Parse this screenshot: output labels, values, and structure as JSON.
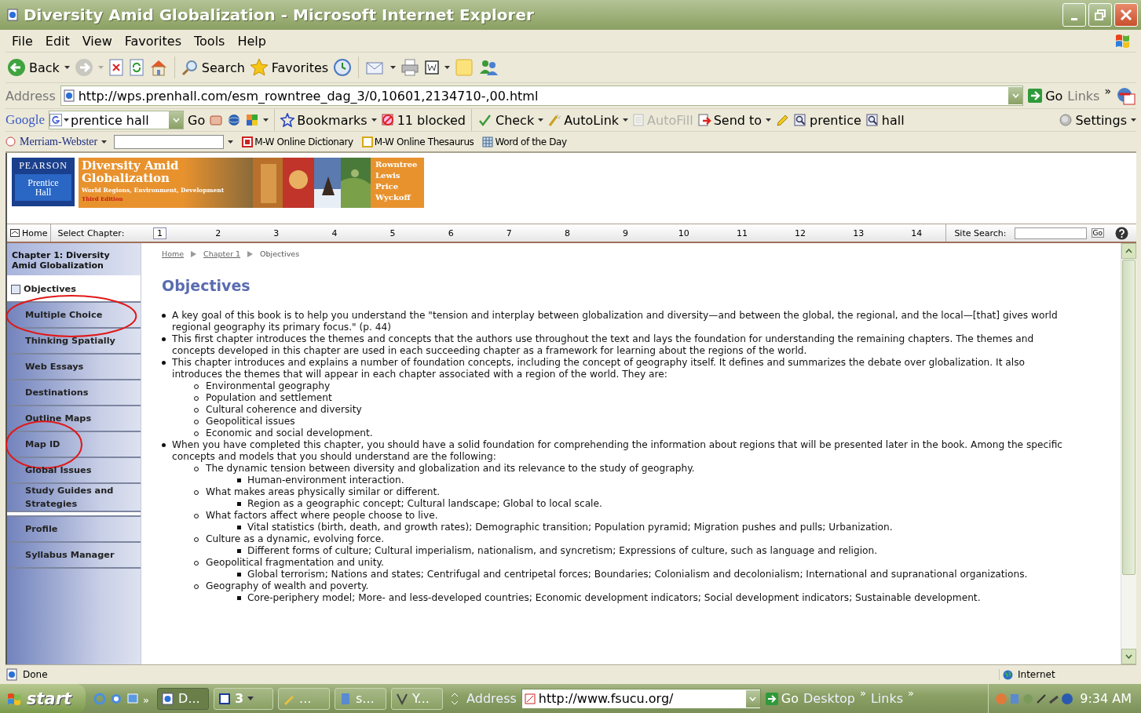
{
  "window": {
    "title": "Diversity Amid Globalization - Microsoft Internet Explorer"
  },
  "menu": [
    "File",
    "Edit",
    "View",
    "Favorites",
    "Tools",
    "Help"
  ],
  "toolbar": {
    "back": "Back",
    "search": "Search",
    "favorites": "Favorites"
  },
  "address_bar": {
    "label": "Address",
    "url": "http://wps.prenhall.com/esm_rowntree_dag_3/0,10601,2134710-,00.html",
    "go": "Go",
    "links": "Links",
    "more": "»"
  },
  "google_bar": {
    "logo": "Google",
    "query": "prentice hall",
    "go": "Go",
    "bookmarks": "Bookmarks",
    "blocked": "11 blocked",
    "check": "Check",
    "autolink": "AutoLink",
    "autofill": {
      "label": "AutoFill",
      "disabled": true
    },
    "send_to": "Send to",
    "terms": [
      "prentice",
      "hall"
    ],
    "settings": "Settings"
  },
  "mw_bar": {
    "name": "Merriam-Webster",
    "links": [
      "M-W Online Dictionary",
      "M-W Online Thesaurus",
      "Word of the Day"
    ]
  },
  "banner": {
    "publisher": "PEARSON",
    "imprint": [
      "Prentice",
      "Hall"
    ],
    "title": [
      "Diversity Amid",
      "Globalization"
    ],
    "subtitle": "World Regions, Environment, Development",
    "edition": "Third Edition",
    "authors": [
      "Rowntree",
      "Lewis",
      "Price",
      "Wyckoff"
    ]
  },
  "chapter_nav": {
    "home": "Home",
    "select_label": "Select Chapter:",
    "chapters": [
      {
        "label": "1",
        "selected": true
      },
      {
        "label": "2",
        "selected": false
      },
      {
        "label": "3",
        "selected": false
      },
      {
        "label": "4",
        "selected": false
      },
      {
        "label": "5",
        "selected": false
      },
      {
        "label": "6",
        "selected": false
      },
      {
        "label": "7",
        "selected": false
      },
      {
        "label": "8",
        "selected": false
      },
      {
        "label": "9",
        "selected": false
      },
      {
        "label": "10",
        "selected": false
      },
      {
        "label": "11",
        "selected": false
      },
      {
        "label": "12",
        "selected": false
      },
      {
        "label": "13",
        "selected": false
      },
      {
        "label": "14",
        "selected": false
      }
    ],
    "search_label": "Site Search:",
    "go": "Go"
  },
  "sidebar": {
    "heading": "Chapter 1: Diversity Amid Globalization",
    "items": [
      {
        "label": "Objectives",
        "selected": true
      },
      {
        "label": "Multiple Choice",
        "selected": false,
        "circled": true
      },
      {
        "label": "Thinking Spatially",
        "selected": false
      },
      {
        "label": "Web Essays",
        "selected": false
      },
      {
        "label": "Destinations",
        "selected": false
      },
      {
        "label": "Outline Maps",
        "selected": false
      },
      {
        "label": "Map ID",
        "selected": false,
        "circled": true
      },
      {
        "label": "Global Issues",
        "selected": false
      },
      {
        "label": "Study Guides and Strategies",
        "selected": false
      }
    ],
    "tools": [
      "Profile",
      "Syllabus Manager"
    ]
  },
  "breadcrumb": [
    {
      "label": "Home",
      "link": true
    },
    {
      "label": "Chapter 1",
      "link": true
    },
    {
      "label": "Objectives",
      "link": false
    }
  ],
  "heading": "Objectives",
  "objectives": [
    {
      "text": "A key goal of this book is to help you understand the \"tension and interplay between globalization and diversity—and between the global, the regional, and the local—[that] gives world regional geography its primary focus.\" (p. 44)"
    },
    {
      "text": "This first chapter introduces the themes and concepts that the authors use throughout the text and lays the foundation for understanding the remaining chapters. The themes and concepts developed in this chapter are used in each succeeding chapter as a framework for learning about the regions of the world."
    },
    {
      "text": "This chapter introduces and explains a number of foundation concepts, including the concept of geography itself. It defines and summarizes the debate over globalization. It also introduces the themes that will appear in each chapter associated with a region of the world. They are:",
      "children": [
        {
          "text": "Environmental geography"
        },
        {
          "text": "Population and settlement"
        },
        {
          "text": "Cultural coherence and diversity"
        },
        {
          "text": "Geopolitical issues"
        },
        {
          "text": "Economic and social development."
        }
      ]
    },
    {
      "text": "When you have completed this chapter, you should have a solid foundation for comprehending the information about regions that will be presented later in the book. Among the specific concepts and models that you should understand are the following:",
      "children": [
        {
          "text": "The dynamic tension between diversity and globalization and its relevance to the study of geography.",
          "children": [
            {
              "text": "Human-environment interaction."
            }
          ]
        },
        {
          "text": "What makes areas physically similar or different.",
          "children": [
            {
              "text": "Region as a geographic concept; Cultural landscape; Global to local scale."
            }
          ]
        },
        {
          "text": "What factors affect where people choose to live.",
          "children": [
            {
              "text": "Vital statistics (birth, death, and growth rates); Demographic transition; Population pyramid; Migration pushes and pulls; Urbanization."
            }
          ]
        },
        {
          "text": "Culture as a dynamic, evolving force.",
          "children": [
            {
              "text": "Different forms of culture; Cultural imperialism, nationalism, and syncretism; Expressions of culture, such as language and religion."
            }
          ]
        },
        {
          "text": "Geopolitical fragmentation and unity.",
          "children": [
            {
              "text": "Global terrorism; Nations and states; Centrifugal and centripetal forces; Boundaries; Colonialism and decolonialism; International and supranational organizations."
            }
          ]
        },
        {
          "text": "Geography of wealth and poverty.",
          "children": [
            {
              "text": "Core-periphery model; More- and less-developed countries; Economic development indicators; Social development indicators; Sustainable development."
            }
          ]
        }
      ]
    }
  ],
  "status_bar": {
    "text": "Done",
    "zone": "Internet"
  },
  "taskbar": {
    "start": "start",
    "more": "»",
    "tasks": [
      {
        "label": "D...",
        "selected": true
      },
      {
        "label": "3",
        "selected": false
      },
      {
        "label": "...",
        "selected": false
      },
      {
        "label": "s...",
        "selected": false
      },
      {
        "label": "Y...",
        "selected": false
      }
    ],
    "address_label": "Address",
    "url": "http://www.fsucu.org/",
    "go": "Go",
    "desktop": "Desktop",
    "links": "Links",
    "clock": "9:34 AM"
  }
}
